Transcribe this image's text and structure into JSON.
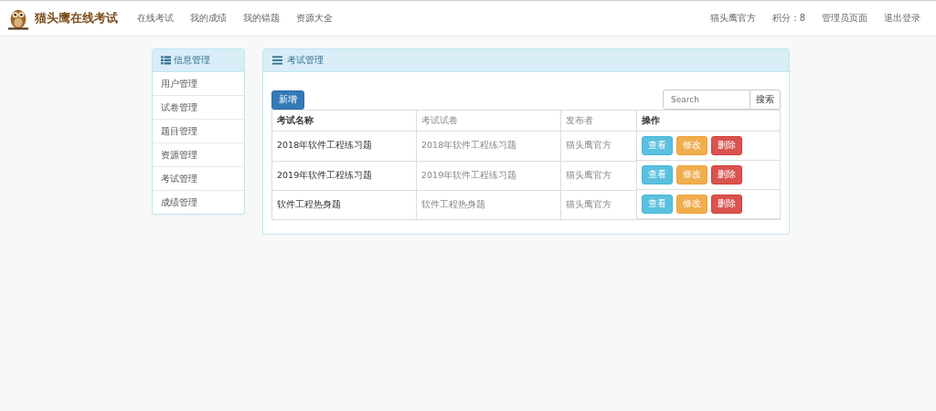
{
  "navbar": {
    "brand": "猫头鹰在线考试",
    "links": [
      "在线考试",
      "我的成绩",
      "我的错题",
      "资源大全"
    ],
    "right_links": [
      "猫头鹰官方",
      "积分：8",
      "管理员页面",
      "退出登录"
    ]
  },
  "sidebar": {
    "title": "信息管理",
    "items": [
      {
        "label": "用户管理",
        "selected": false
      },
      {
        "label": "试卷管理",
        "selected": false
      },
      {
        "label": "题目管理",
        "selected": false
      },
      {
        "label": "资源管理",
        "selected": false
      },
      {
        "label": "考试管理",
        "selected": false
      },
      {
        "label": "成绩管理",
        "selected": false
      }
    ]
  },
  "panel": {
    "title": "考试管理",
    "add_button": "新增",
    "search": {
      "placeholder": "Search",
      "button": "搜索"
    },
    "table": {
      "columns": [
        "考试名称",
        "考试试卷",
        "发布者",
        "操作"
      ],
      "rows": [
        {
          "cells": [
            "2018年软件工程练习题",
            "2018年软件工程练习题",
            "猫头鹰官方"
          ],
          "actions": [
            {
              "label": "查看",
              "kind": "info"
            },
            {
              "label": "修改",
              "kind": "warning"
            },
            {
              "label": "删除",
              "kind": "danger"
            }
          ]
        },
        {
          "cells": [
            "2019年软件工程练习题",
            "2019年软件工程练习题",
            "猫头鹰官方"
          ],
          "actions": [
            {
              "label": "查看",
              "kind": "info"
            },
            {
              "label": "修改",
              "kind": "warning"
            },
            {
              "label": "删除",
              "kind": "danger"
            }
          ]
        },
        {
          "cells": [
            "软件工程热身题",
            "软件工程热身题",
            "猫头鹰官方"
          ],
          "actions": [
            {
              "label": "查看",
              "kind": "info"
            },
            {
              "label": "修改",
              "kind": "warning"
            },
            {
              "label": "删除",
              "kind": "danger"
            }
          ]
        }
      ]
    }
  }
}
